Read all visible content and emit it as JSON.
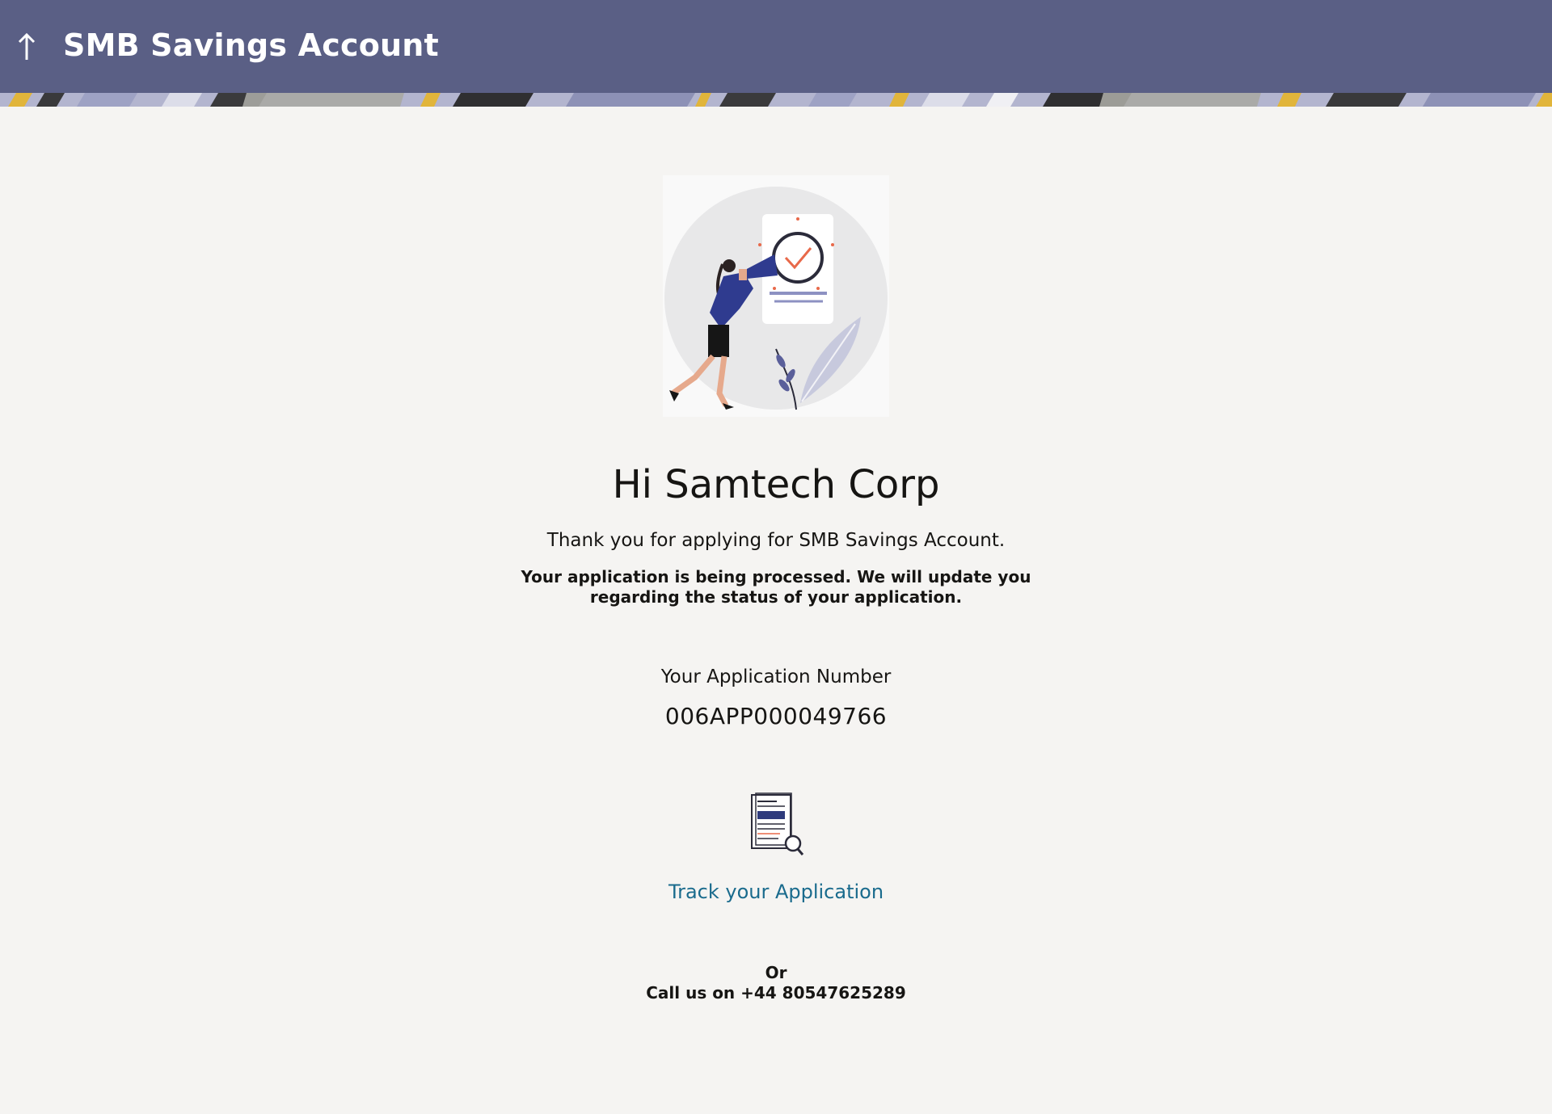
{
  "header": {
    "title": "SMB Savings Account",
    "back_icon": "arrow-up-icon",
    "background_color": "#5a5f85"
  },
  "confirmation": {
    "greeting": "Hi Samtech Corp",
    "thank_you": "Thank you for applying for SMB Savings Account.",
    "processing_message": "Your application is being processed. We will update you regarding the status of your application.",
    "application_number_label": "Your Application Number",
    "application_number": "006APP000049766",
    "illustration_icon": "woman-megaphone-checkmark-illustration"
  },
  "tracking": {
    "icon": "document-search-icon",
    "link_label": "Track your Application",
    "link_color": "#1a6b8d"
  },
  "contact": {
    "or_label": "Or",
    "call_text": "Call us on +44 80547625289"
  }
}
